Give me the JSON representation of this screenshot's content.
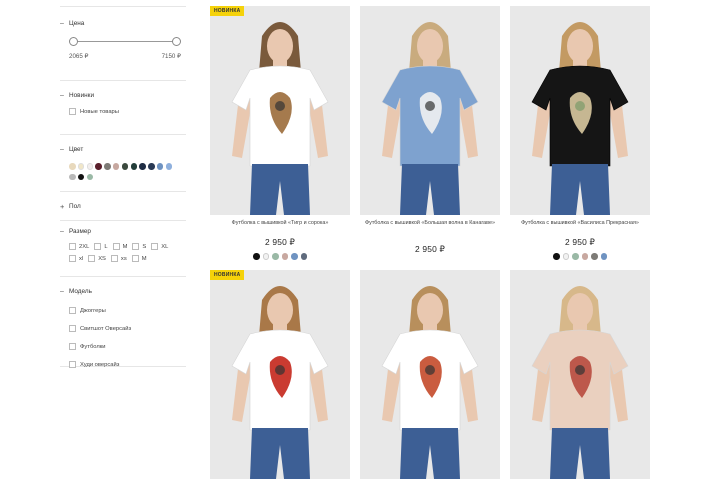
{
  "filters": {
    "price": {
      "label": "Цена",
      "min": "2065 ₽",
      "max": "7150 ₽"
    },
    "new": {
      "label": "Новинки",
      "option": "Новые товары"
    },
    "color": {
      "label": "Цвет",
      "swatches": [
        "#e8d9bd",
        "#f0e6c8",
        "#f2eeee",
        "#5a1f2b",
        "#7d7b76",
        "#c7a8a0",
        "#3b4a3e",
        "#233e3a",
        "#1f2d44",
        "#2a3a55",
        "#6f93c1",
        "#8fb0dd",
        "#b9b9b9",
        "#111111",
        "#9ab9a6"
      ]
    },
    "gender": {
      "label": "Пол"
    },
    "size": {
      "label": "Размер",
      "options": [
        "2XL",
        "L",
        "M",
        "S",
        "XL",
        "xl",
        "XS",
        "xs",
        "M"
      ]
    },
    "model": {
      "label": "Модель",
      "options": [
        "Джоггеры",
        "Свитшот Оверсайз",
        "Футболки",
        "Худи оверсайз"
      ]
    }
  },
  "products": [
    {
      "badge": "НОВИНКА",
      "title": "Футболка с вышивкой «Тигр и сорока»",
      "price": "2 950 ₽",
      "colors": [
        "#111111",
        "#f2f2f2",
        "#9ab9a6",
        "#c8a8a0",
        "#6f93c1",
        "#5f6b7d"
      ],
      "shirt": "#ffffff",
      "hair": "#7a5a3c",
      "art": "#9b6b3a"
    },
    {
      "badge": "",
      "title": "Футболка с вышивкой «Большая волна в Канагаве»",
      "price": "2 950 ₽",
      "colors": [],
      "shirt": "#7ea2cf",
      "hair": "#c9ab7e",
      "art": "#f1f1f1"
    },
    {
      "badge": "",
      "title": "Футболка с вышивкой «Василиса Прекрасная»",
      "price": "2 950 ₽",
      "colors": [
        "#111111",
        "#f2f2f2",
        "#9ab9a6",
        "#c8a8a0",
        "#7d7b76",
        "#6f93c1"
      ],
      "shirt": "#151515",
      "hair": "#c39a63",
      "art": "#d9c9a0"
    },
    {
      "badge": "НОВИНКА",
      "title": "",
      "price": "",
      "colors": [],
      "shirt": "#ffffff",
      "hair": "#a97848",
      "art": "#c4261b"
    },
    {
      "badge": "",
      "title": "",
      "price": "",
      "colors": [],
      "shirt": "#ffffff",
      "hair": "#b88f5c",
      "art": "#c44a2a"
    },
    {
      "badge": "",
      "title": "",
      "price": "",
      "colors": [],
      "shirt": "#ead0bf",
      "hair": "#d7b88a",
      "art": "#b84a3e"
    }
  ]
}
